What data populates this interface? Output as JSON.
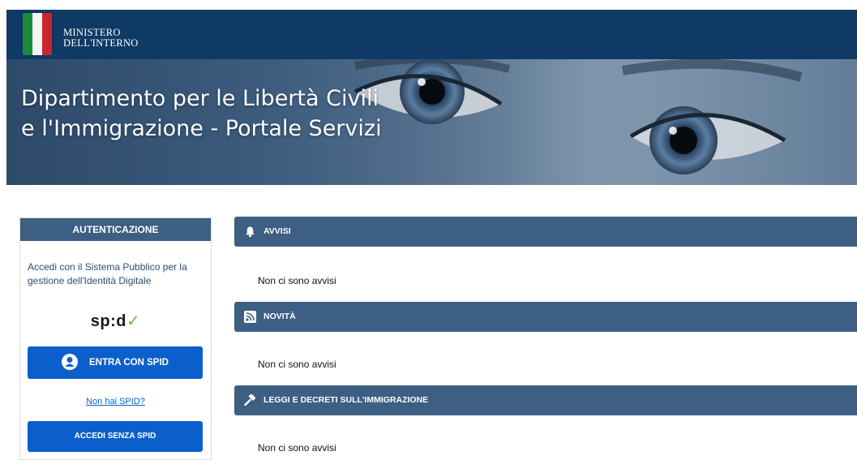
{
  "header": {
    "ministry_line1": "MINISTERO",
    "ministry_line2": "DELL'INTERNO",
    "bar_color": "#0f3a66"
  },
  "hero": {
    "title_line1": "Dipartimento per le Libertà Civili",
    "title_line2": "e l'Immigrazione - Portale Servizi"
  },
  "auth": {
    "heading": "AUTENTICAZIONE",
    "desc_line1": "Accedi con il Sistema Pubblico per la",
    "desc_line2": "gestione dell'Identità Digitale",
    "spid_logo_text": "sp:d",
    "spid_check": "✓",
    "spid_button": "ENTRA CON SPID",
    "no_spid_link": "Non hai SPID?",
    "no_spid_button": "ACCEDI SENZA SPID",
    "button_color": "#0b5fcd"
  },
  "sections": [
    {
      "title": "AVVISI",
      "icon": "bell-icon",
      "body": "Non ci sono avvisi"
    },
    {
      "title": "NOVITÀ",
      "icon": "rss-icon",
      "body": "Non ci sono avvisi"
    },
    {
      "title": "LEGGI E DECRETI SULL'IMMIGRAZIONE",
      "icon": "gavel-icon",
      "body": "Non ci sono avvisi"
    }
  ],
  "colors": {
    "section_header": "#3d5f84"
  }
}
